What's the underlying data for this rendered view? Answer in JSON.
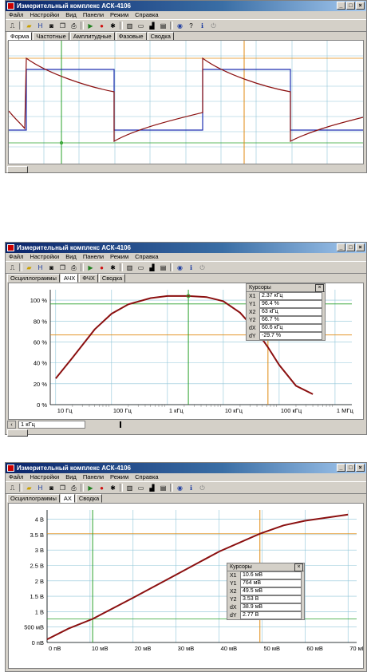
{
  "windows": [
    {
      "title": "Измерительный комплекс АСК-4106",
      "menu": [
        "Файл",
        "Настройки",
        "Вид",
        "Панели",
        "Режим",
        "Справка"
      ],
      "tabs": [
        {
          "label": "Форма",
          "active": true
        },
        {
          "label": "Частотные",
          "active": false
        },
        {
          "label": "Амплитудные",
          "active": false
        },
        {
          "label": "Фазовые",
          "active": false
        },
        {
          "label": "Сводка",
          "active": false
        }
      ]
    },
    {
      "title": "Измерительный комплекс АСК-4106",
      "menu": [
        "Файл",
        "Настройки",
        "Вид",
        "Панели",
        "Режим",
        "Справка"
      ],
      "tabs": [
        {
          "label": "Осциллограммы",
          "active": false
        },
        {
          "label": "АЧХ",
          "active": true
        },
        {
          "label": "ФЧХ",
          "active": false
        },
        {
          "label": "Сводка",
          "active": false
        }
      ],
      "cursors": {
        "header": "Курсоры",
        "rows": [
          {
            "k": "X1",
            "v": "2.37 кГц"
          },
          {
            "k": "Y1",
            "v": "96.4 %"
          },
          {
            "k": "X2",
            "v": "63 кГц"
          },
          {
            "k": "Y2",
            "v": "66.7 %"
          },
          {
            "k": "dX",
            "v": "60.6 кГц"
          },
          {
            "k": "dY",
            "v": "-29.7 %"
          }
        ]
      },
      "freq_field": "1 кГц",
      "chart_data": {
        "type": "line",
        "x_scale": "log",
        "x_ticks": [
          "10 Гц",
          "100 Гц",
          "1 кГц",
          "10 кГц",
          "100 кГц",
          "1 МГц"
        ],
        "y_ticks": [
          "0 %",
          "20 %",
          "40 %",
          "60 %",
          "80 %",
          "100 %"
        ],
        "ylim": [
          0,
          110
        ],
        "xlim_hz": [
          8,
          2000000
        ],
        "points": [
          [
            10,
            25
          ],
          [
            20,
            45
          ],
          [
            50,
            72
          ],
          [
            100,
            87
          ],
          [
            200,
            96
          ],
          [
            500,
            102
          ],
          [
            1000,
            104
          ],
          [
            2370,
            104
          ],
          [
            5000,
            103
          ],
          [
            10000,
            99
          ],
          [
            20000,
            88
          ],
          [
            40000,
            70
          ],
          [
            63000,
            55
          ],
          [
            100000,
            38
          ],
          [
            200000,
            18
          ],
          [
            400000,
            10
          ]
        ]
      }
    },
    {
      "title": "Измерительный комплекс АСК-4106",
      "menu": [
        "Файл",
        "Настройки",
        "Вид",
        "Панели",
        "Режим",
        "Справка"
      ],
      "tabs": [
        {
          "label": "Осциллограммы",
          "active": false
        },
        {
          "label": "АХ",
          "active": true
        },
        {
          "label": "Сводка",
          "active": false
        }
      ],
      "cursors": {
        "header": "Курсоры",
        "rows": [
          {
            "k": "X1",
            "v": "10.6 мВ"
          },
          {
            "k": "Y1",
            "v": "764 мВ"
          },
          {
            "k": "X2",
            "v": "49.5 мВ"
          },
          {
            "k": "Y2",
            "v": "3.53 В"
          },
          {
            "k": "dX",
            "v": "38.9 мВ"
          },
          {
            "k": "dY",
            "v": "2.77 В"
          }
        ]
      },
      "chart_data": {
        "type": "line",
        "x_ticks": [
          "0 пВ",
          "10 мВ",
          "20 мВ",
          "30 мВ",
          "40 мВ",
          "50 мВ",
          "60 мВ",
          "70 мВ"
        ],
        "y_ticks": [
          "0 пВ",
          "500 мВ",
          "1 В",
          "1.5 В",
          "2 В",
          "2.5 В",
          "3 В",
          "3.5 В",
          "4 В"
        ],
        "xlim": [
          0,
          72
        ],
        "ylim": [
          0,
          4.3
        ],
        "points": [
          [
            0,
            0.1
          ],
          [
            5,
            0.45
          ],
          [
            10.6,
            0.764
          ],
          [
            20,
            1.45
          ],
          [
            30,
            2.2
          ],
          [
            40,
            2.95
          ],
          [
            49.5,
            3.53
          ],
          [
            55,
            3.8
          ],
          [
            60,
            3.95
          ],
          [
            70,
            4.15
          ]
        ]
      }
    }
  ],
  "colors": {
    "signal_blue": "#1f2fb0",
    "signal_red": "#8b1010",
    "cursor_green": "#2aa02a",
    "cursor_orange": "#e08a10",
    "grid": "#8fc5d8"
  }
}
